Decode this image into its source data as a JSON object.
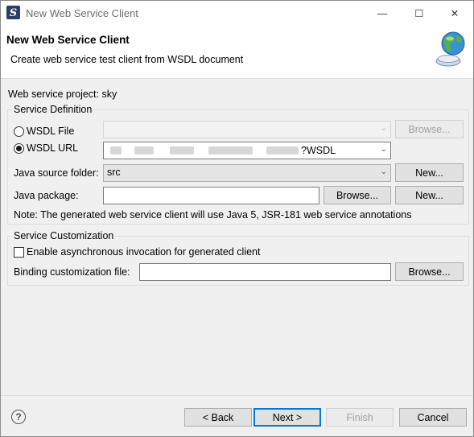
{
  "window": {
    "title": "New Web Service Client",
    "minimize_glyph": "—",
    "maximize_glyph": "☐",
    "close_glyph": "✕"
  },
  "header": {
    "title": "New Web Service Client",
    "description": "Create web service test client from WSDL document",
    "icon": "web-service-globe-icon"
  },
  "project_label": "Web service project: sky",
  "service_definition": {
    "legend": "Service Definition",
    "wsdl_file": {
      "label": "WSDL File",
      "selected": false,
      "value": "",
      "browse_label": "Browse..."
    },
    "wsdl_url": {
      "label": "WSDL URL",
      "selected": true,
      "value": "?WSDL"
    },
    "source_folder": {
      "label": "Java source folder:",
      "value": "src",
      "new_label": "New..."
    },
    "package": {
      "label": "Java package:",
      "value": "",
      "browse_label": "Browse...",
      "new_label": "New..."
    },
    "note": "Note: The generated web service client will use Java 5, JSR-181 web service annotations"
  },
  "service_customization": {
    "legend": "Service Customization",
    "async_label": "Enable asynchronous invocation for generated client",
    "async_checked": false,
    "binding_label": "Binding customization file:",
    "binding_value": "",
    "browse_label": "Browse..."
  },
  "footer": {
    "help_glyph": "?",
    "back_label": "< Back",
    "next_label": "Next >",
    "finish_label": "Finish",
    "cancel_label": "Cancel"
  },
  "colors": {
    "accent": "#0078d7",
    "disabled_text": "#a0a0a0"
  }
}
